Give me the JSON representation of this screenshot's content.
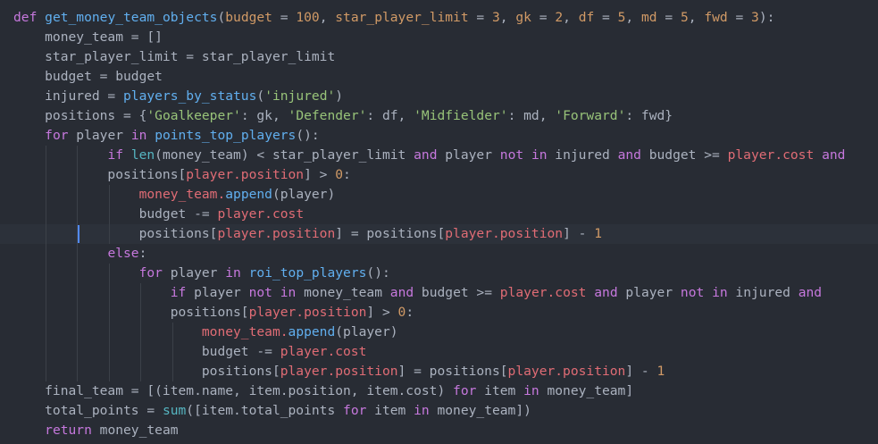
{
  "editor": {
    "language": "python",
    "active_line_index": 11,
    "colors": {
      "background": "#282c34",
      "active_line": "#2c313a",
      "cursor": "#528bff",
      "default": "#abb2bf",
      "keyword": "#c678dd",
      "function": "#61afef",
      "number": "#d19a66",
      "string": "#98c379",
      "attribute": "#e06c75",
      "builtin": "#56b6c2"
    },
    "lines": [
      [
        [
          "kw",
          "def"
        ],
        [
          "p",
          " "
        ],
        [
          "fn",
          "get_money_team_objects"
        ],
        [
          "p",
          "("
        ],
        [
          "num",
          "budget"
        ],
        [
          "p",
          " = "
        ],
        [
          "num",
          "100"
        ],
        [
          "p",
          ", "
        ],
        [
          "num",
          "star_player_limit"
        ],
        [
          "p",
          " = "
        ],
        [
          "num",
          "3"
        ],
        [
          "p",
          ", "
        ],
        [
          "num",
          "gk"
        ],
        [
          "p",
          " = "
        ],
        [
          "num",
          "2"
        ],
        [
          "p",
          ", "
        ],
        [
          "num",
          "df"
        ],
        [
          "p",
          " = "
        ],
        [
          "num",
          "5"
        ],
        [
          "p",
          ", "
        ],
        [
          "num",
          "md"
        ],
        [
          "p",
          " = "
        ],
        [
          "num",
          "5"
        ],
        [
          "p",
          ", "
        ],
        [
          "num",
          "fwd"
        ],
        [
          "p",
          " = "
        ],
        [
          "num",
          "3"
        ],
        [
          "p",
          "):"
        ]
      ],
      [
        [
          "p",
          "    money_team = []"
        ]
      ],
      [
        [
          "p",
          "    star_player_limit = star_player_limit"
        ]
      ],
      [
        [
          "p",
          "    budget = budget"
        ]
      ],
      [
        [
          "p",
          "    injured = "
        ],
        [
          "fn",
          "players_by_status"
        ],
        [
          "p",
          "("
        ],
        [
          "str",
          "'injured'"
        ],
        [
          "p",
          ")"
        ]
      ],
      [
        [
          "p",
          "    positions = {"
        ],
        [
          "str",
          "'Goalkeeper'"
        ],
        [
          "p",
          ": gk, "
        ],
        [
          "str",
          "'Defender'"
        ],
        [
          "p",
          ": df, "
        ],
        [
          "str",
          "'Midfielder'"
        ],
        [
          "p",
          ": md, "
        ],
        [
          "str",
          "'Forward'"
        ],
        [
          "p",
          ": fwd}"
        ]
      ],
      [
        [
          "p",
          "    "
        ],
        [
          "kw",
          "for"
        ],
        [
          "p",
          " player "
        ],
        [
          "kw",
          "in"
        ],
        [
          "p",
          " "
        ],
        [
          "fn",
          "points_top_players"
        ],
        [
          "p",
          "():"
        ]
      ],
      [
        [
          "p",
          "            "
        ],
        [
          "kw",
          "if"
        ],
        [
          "p",
          " "
        ],
        [
          "bi",
          "len"
        ],
        [
          "p",
          "(money_team) < star_player_limit "
        ],
        [
          "kw",
          "and"
        ],
        [
          "p",
          " player "
        ],
        [
          "kw",
          "not"
        ],
        [
          "p",
          " "
        ],
        [
          "kw",
          "in"
        ],
        [
          "p",
          " injured "
        ],
        [
          "kw",
          "and"
        ],
        [
          "p",
          " budget >= "
        ],
        [
          "attr",
          "player.cost"
        ],
        [
          "p",
          " "
        ],
        [
          "kw",
          "and"
        ]
      ],
      [
        [
          "p",
          "            positions["
        ],
        [
          "attr",
          "player.position"
        ],
        [
          "p",
          "] > "
        ],
        [
          "num",
          "0"
        ],
        [
          "p",
          ":"
        ]
      ],
      [
        [
          "p",
          "                "
        ],
        [
          "attr",
          "money_team."
        ],
        [
          "fn",
          "append"
        ],
        [
          "p",
          "(player)"
        ]
      ],
      [
        [
          "p",
          "                budget -= "
        ],
        [
          "attr",
          "player.cost"
        ]
      ],
      [
        [
          "p",
          "                positions["
        ],
        [
          "attr",
          "player.position"
        ],
        [
          "p",
          "] = positions["
        ],
        [
          "attr",
          "player.position"
        ],
        [
          "p",
          "] - "
        ],
        [
          "num",
          "1"
        ]
      ],
      [
        [
          "p",
          "            "
        ],
        [
          "kw",
          "else"
        ],
        [
          "p",
          ":"
        ]
      ],
      [
        [
          "p",
          "                "
        ],
        [
          "kw",
          "for"
        ],
        [
          "p",
          " player "
        ],
        [
          "kw",
          "in"
        ],
        [
          "p",
          " "
        ],
        [
          "fn",
          "roi_top_players"
        ],
        [
          "p",
          "():"
        ]
      ],
      [
        [
          "p",
          "                    "
        ],
        [
          "kw",
          "if"
        ],
        [
          "p",
          " player "
        ],
        [
          "kw",
          "not"
        ],
        [
          "p",
          " "
        ],
        [
          "kw",
          "in"
        ],
        [
          "p",
          " money_team "
        ],
        [
          "kw",
          "and"
        ],
        [
          "p",
          " budget >= "
        ],
        [
          "attr",
          "player.cost"
        ],
        [
          "p",
          " "
        ],
        [
          "kw",
          "and"
        ],
        [
          "p",
          " player "
        ],
        [
          "kw",
          "not"
        ],
        [
          "p",
          " "
        ],
        [
          "kw",
          "in"
        ],
        [
          "p",
          " injured "
        ],
        [
          "kw",
          "and"
        ]
      ],
      [
        [
          "p",
          "                    positions["
        ],
        [
          "attr",
          "player.position"
        ],
        [
          "p",
          "] > "
        ],
        [
          "num",
          "0"
        ],
        [
          "p",
          ":"
        ]
      ],
      [
        [
          "p",
          "                        "
        ],
        [
          "attr",
          "money_team."
        ],
        [
          "fn",
          "append"
        ],
        [
          "p",
          "(player)"
        ]
      ],
      [
        [
          "p",
          "                        budget -= "
        ],
        [
          "attr",
          "player.cost"
        ]
      ],
      [
        [
          "p",
          "                        positions["
        ],
        [
          "attr",
          "player.position"
        ],
        [
          "p",
          "] = positions["
        ],
        [
          "attr",
          "player.position"
        ],
        [
          "p",
          "] - "
        ],
        [
          "num",
          "1"
        ]
      ],
      [
        [
          "p",
          "    final_team = [(item.name, item.position, item.cost) "
        ],
        [
          "kw",
          "for"
        ],
        [
          "p",
          " item "
        ],
        [
          "kw",
          "in"
        ],
        [
          "p",
          " money_team]"
        ]
      ],
      [
        [
          "p",
          "    total_points = "
        ],
        [
          "bi",
          "sum"
        ],
        [
          "p",
          "([item.total_points "
        ],
        [
          "kw",
          "for"
        ],
        [
          "p",
          " item "
        ],
        [
          "kw",
          "in"
        ],
        [
          "p",
          " money_team])"
        ]
      ],
      [
        [
          "p",
          "    "
        ],
        [
          "kw",
          "return"
        ],
        [
          "p",
          " money_team"
        ]
      ]
    ]
  }
}
